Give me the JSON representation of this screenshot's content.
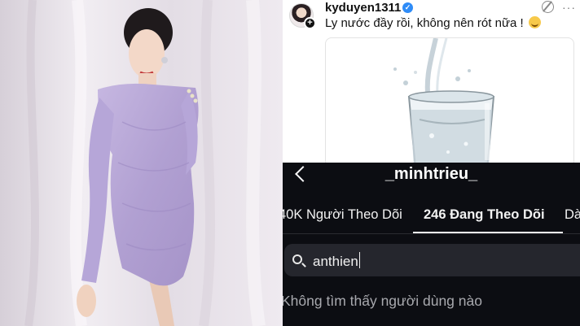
{
  "post": {
    "username": "kyduyen1311",
    "caption": "Ly nước đầy rồi, không nên rót nữa !",
    "more_label": "···"
  },
  "profile": {
    "username": "_minhtrieu_",
    "tabs": [
      {
        "label": "40K Người Theo Dõi"
      },
      {
        "label": "246 Đang Theo Dõi"
      },
      {
        "label": "Dà"
      }
    ],
    "search": {
      "value": "anthien"
    },
    "empty_message": "Không tìm thấy người dùng nào"
  },
  "colors": {
    "dress": "#b8a7d6",
    "dark_background": "#0c0d12",
    "search_background": "#25262d",
    "verified": "#2f8cf7"
  },
  "icons": [
    "plus-icon",
    "verified-icon",
    "repost-icon",
    "more-icon",
    "emoji-icon",
    "back-icon",
    "search-icon"
  ]
}
